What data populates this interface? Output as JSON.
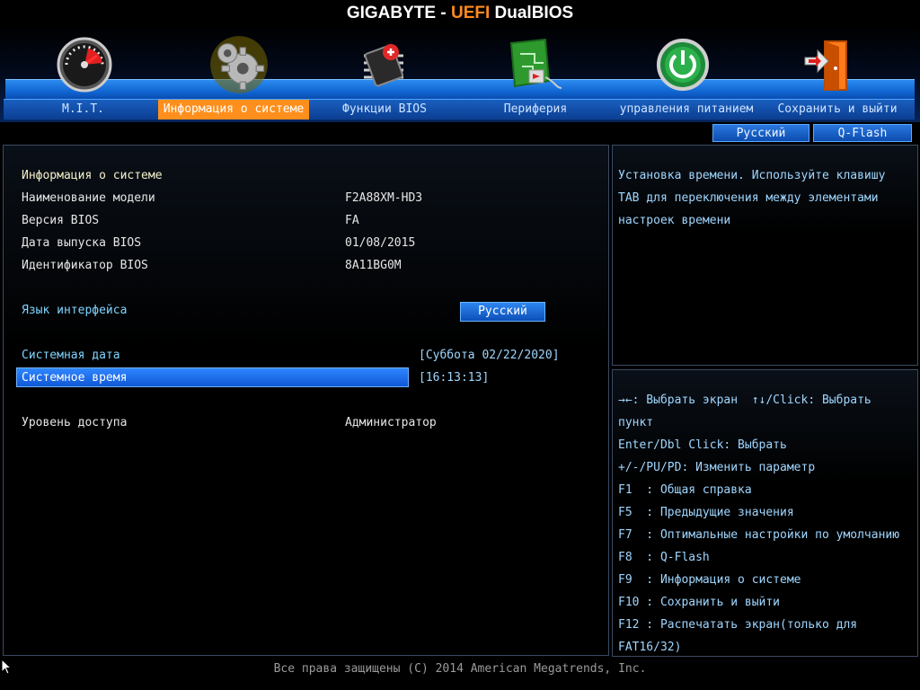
{
  "header": {
    "title_brand": "GIGABYTE - ",
    "title_accent": "UEFI",
    "title_rest": " DualBIOS",
    "tabs": [
      {
        "label": "M.I.T.",
        "icon": "speedometer-icon"
      },
      {
        "label": "Информация о системе",
        "icon": "gears-icon",
        "active": true
      },
      {
        "label": "Функции BIOS",
        "icon": "chip-icon"
      },
      {
        "label": "Периферия",
        "icon": "circuit-board-icon"
      },
      {
        "label": "управления питанием",
        "icon": "power-icon"
      },
      {
        "label": "Сохранить и выйти",
        "icon": "exit-door-icon"
      }
    ],
    "lang_button": "Русский",
    "qflash_button": "Q-Flash"
  },
  "main": {
    "section_title": "Информация о системе",
    "info": [
      {
        "label": "Наименование модели",
        "value": "F2A88XM-HD3"
      },
      {
        "label": "Версия BIOS",
        "value": "FA"
      },
      {
        "label": "Дата выпуска BIOS",
        "value": "01/08/2015"
      },
      {
        "label": "Идентификатор BIOS",
        "value": "8A11BG0M"
      }
    ],
    "language_label": "Язык интерфейса",
    "language_value": "Русский",
    "date_label": "Системная дата",
    "date_value": "[Суббота 02/22/2020]",
    "time_label": "Системное время",
    "time_value": "[16:13:13]",
    "access_label": "Уровень доступа",
    "access_value": "Администратор"
  },
  "help": {
    "lines": [
      "Установка времени. Используйте клавишу",
      "TAB для переключения между элементами",
      "настроек времени"
    ]
  },
  "keys": {
    "lines": [
      "→←: Выбрать экран  ↑↓/Click: Выбрать",
      "пункт",
      "Enter/Dbl Click: Выбрать",
      "+/-/PU/PD: Изменить параметр",
      "F1  : Общая справка",
      "F5  : Предыдущие значения",
      "F7  : Оптимальные настройки по умолчанию",
      "F8  : Q-Flash",
      "F9  : Информация о системе",
      "F10 : Сохранить и выйти",
      "F12 : Распечатать экран(только для",
      "FAT16/32)"
    ]
  },
  "footer": {
    "copyright": "Все права защищены (C) 2014 American Megatrends, Inc."
  },
  "colors": {
    "accent_orange": "#ff8f1c",
    "selection_blue": "#1f6fe8",
    "help_cyan": "#9fd6ff"
  }
}
